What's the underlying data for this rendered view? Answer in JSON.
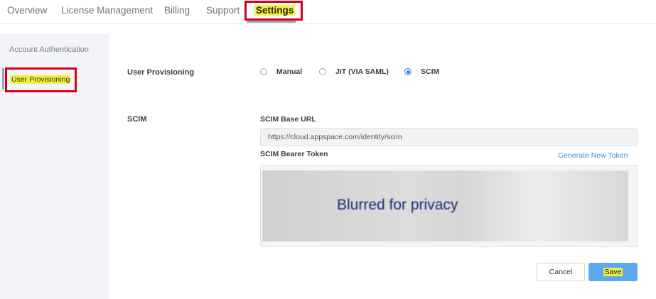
{
  "tabs": {
    "overview": "Overview",
    "license": "License Management",
    "billing": "Billing",
    "support": "Support",
    "settings": "Settings"
  },
  "sidebar": {
    "auth": "Account Authentication",
    "provisioning": "User Provisioning"
  },
  "provisioning": {
    "label": "User Provisioning",
    "options": {
      "manual": "Manual",
      "jit": "JIT (VIA SAML)",
      "scim": "SCIM"
    },
    "selected": "SCIM"
  },
  "scim": {
    "label": "SCIM",
    "base_url_label": "SCIM Base URL",
    "base_url_value": "https://cloud.appspace.com/identity/scim",
    "token_label": "SCIM Bearer Token",
    "generate_link": "Generate New Token",
    "blur_text": "Blurred for privacy"
  },
  "actions": {
    "cancel": "Cancel",
    "save": "Save"
  },
  "colors": {
    "accent": "#2f7fd8",
    "highlight": "#f4f13a",
    "annotation": "#d6001c",
    "save_button": "#5fa7ee"
  }
}
